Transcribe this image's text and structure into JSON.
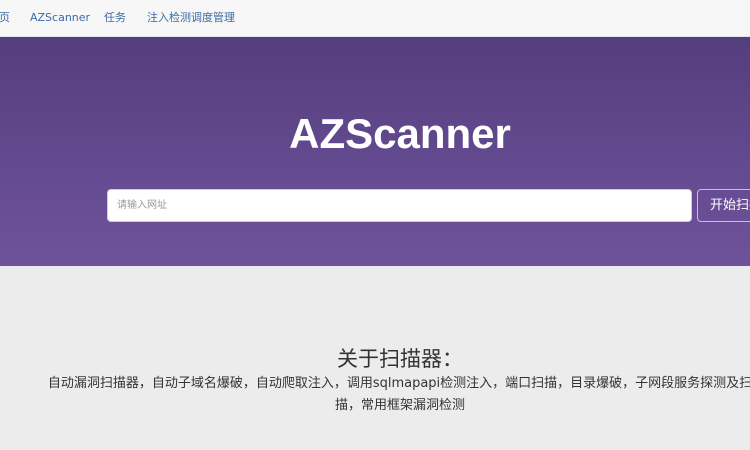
{
  "nav": {
    "items": [
      {
        "label": "首页"
      },
      {
        "label": "AZScanner"
      },
      {
        "label": "任务"
      },
      {
        "label": "注入检测调度管理"
      }
    ]
  },
  "hero": {
    "title": "AZScanner",
    "url_placeholder": "请输入网址",
    "scan_button_label": "开始扫描"
  },
  "about": {
    "title": "关于扫描器：",
    "description_line1": "自动漏洞扫描器，自动子域名爆破，自动爬取注入，调用sqlmapapi检测注入，端口扫描，目录爆破，子网段服务探测及扫",
    "description_line2": "描，常用框架漏洞检测"
  },
  "colors": {
    "hero_top": "#543e7c",
    "hero_bottom": "#6f529a",
    "nav_link": "#3c6aa5",
    "background": "#ececec"
  }
}
